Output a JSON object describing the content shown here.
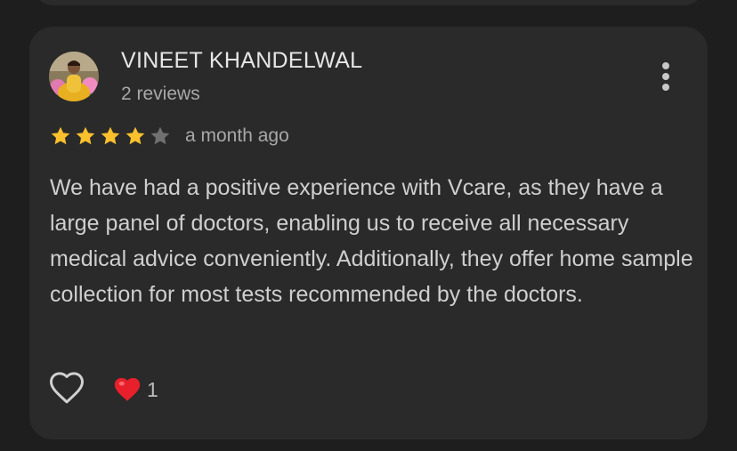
{
  "review": {
    "author_name": "VINEET KHANDELWAL",
    "author_reviews": "2 reviews",
    "rating": 4,
    "rating_max": 5,
    "time_ago": "a month ago",
    "text": "We have had a positive experience with Vcare, as they have a large panel of doctors, enabling us to receive all necessary medical advice conveniently. Additionally, they offer home sample collection for most tests recommended by the doctors.",
    "reaction_emoji": "heart",
    "reaction_count": "1"
  },
  "icons": {
    "menu": "more-vertical-icon",
    "like": "heart-outline-icon",
    "reaction": "red-heart-icon",
    "star": "star-icon"
  },
  "colors": {
    "background": "#1e1e1e",
    "card": "#2a2a2a",
    "star_filled": "#fbc02d",
    "star_empty": "#707070",
    "heart_red": "#e8202c"
  }
}
